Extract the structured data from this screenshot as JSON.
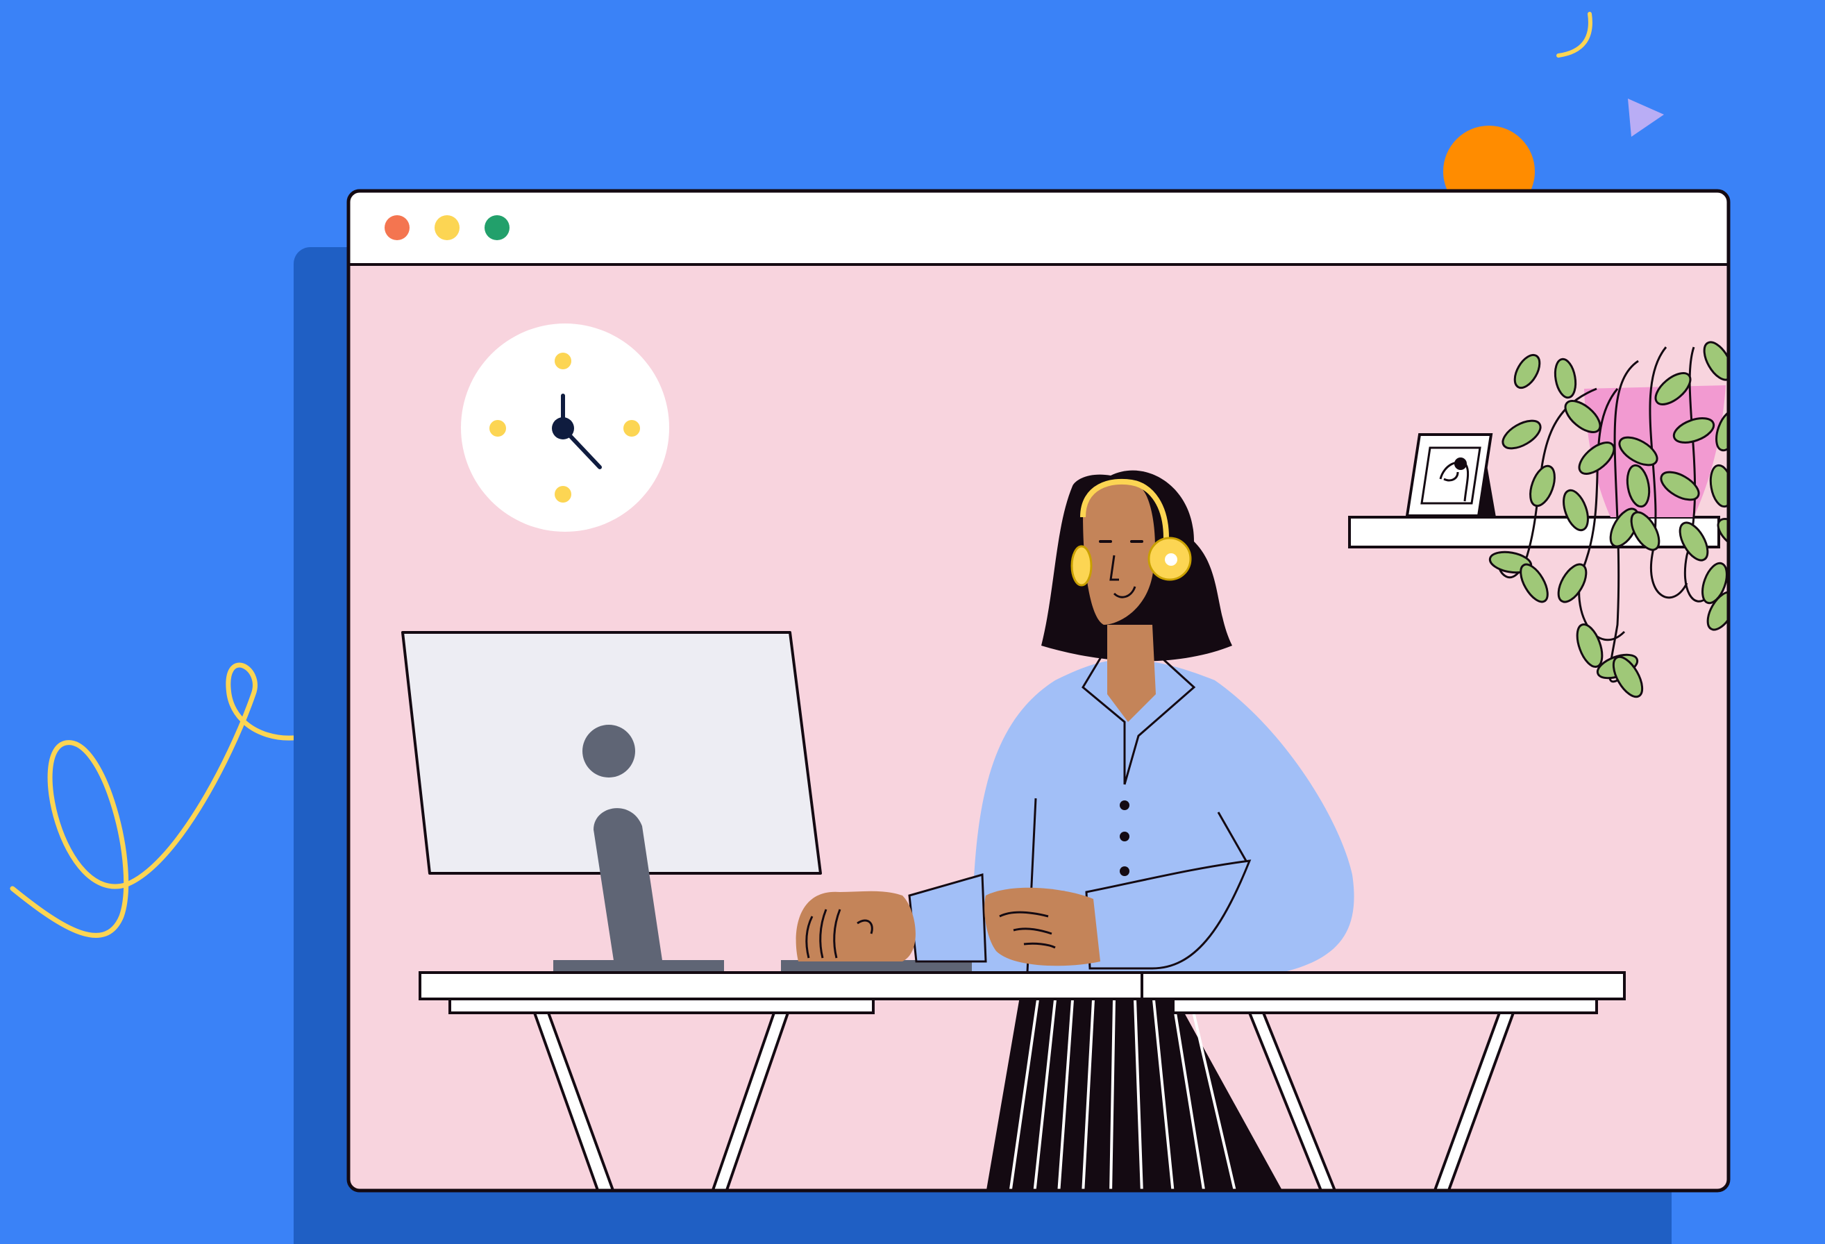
{
  "scene": {
    "background_color": "#3a82f7",
    "shadow_panel_color": "#1f5fc4",
    "browser": {
      "chrome_color": "#ffffff",
      "content_color": "#f8d4de",
      "window_controls": [
        {
          "name": "close",
          "color": "#f47550"
        },
        {
          "name": "minimize",
          "color": "#fcd553"
        },
        {
          "name": "maximize",
          "color": "#22a06b"
        }
      ]
    },
    "clock": {
      "face_color": "#ffffff",
      "marker_color": "#fcd553",
      "hand_color": "#0f1c3f"
    },
    "person": {
      "skin_color": "#c48459",
      "hair_color": "#140a12",
      "shirt_color": "#a2bff7",
      "headphone_color": "#fcd553",
      "skirt_color": "#140a12"
    },
    "monitor": {
      "screen_color": "#ededf3",
      "stand_color": "#5f6575"
    },
    "plant": {
      "pot_color": "#f29ad1",
      "leaf_color": "#9fc878"
    },
    "decorations": {
      "orange_circle": "#ff8c00",
      "triangle": "#b9adf5",
      "squiggle": "#fcd553"
    }
  }
}
